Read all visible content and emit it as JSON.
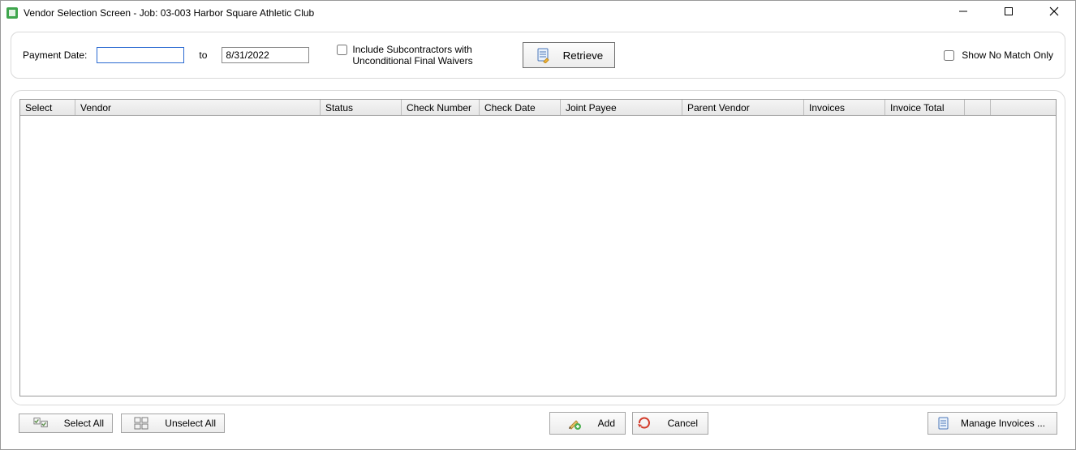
{
  "window": {
    "title": "Vendor Selection Screen - Job: 03-003 Harbor Square Athletic Club"
  },
  "filters": {
    "payment_date_label": "Payment Date:",
    "payment_date_from": "",
    "to_label": "to",
    "payment_date_to": "8/31/2022",
    "include_subs_label": "Include Subcontractors with Unconditional Final Waivers",
    "retrieve_label": "Retrieve",
    "show_no_match_label": "Show No Match Only"
  },
  "grid": {
    "columns": {
      "select": "Select",
      "vendor": "Vendor",
      "status": "Status",
      "check_number": "Check Number",
      "check_date": "Check Date",
      "joint_payee": "Joint Payee",
      "parent_vendor": "Parent Vendor",
      "invoices": "Invoices",
      "invoice_total": "Invoice Total"
    },
    "rows": []
  },
  "footer": {
    "select_all_label": "Select All",
    "unselect_all_label": "Unselect All",
    "add_label": "Add",
    "cancel_label": "Cancel",
    "manage_invoices_label": "Manage Invoices ..."
  }
}
